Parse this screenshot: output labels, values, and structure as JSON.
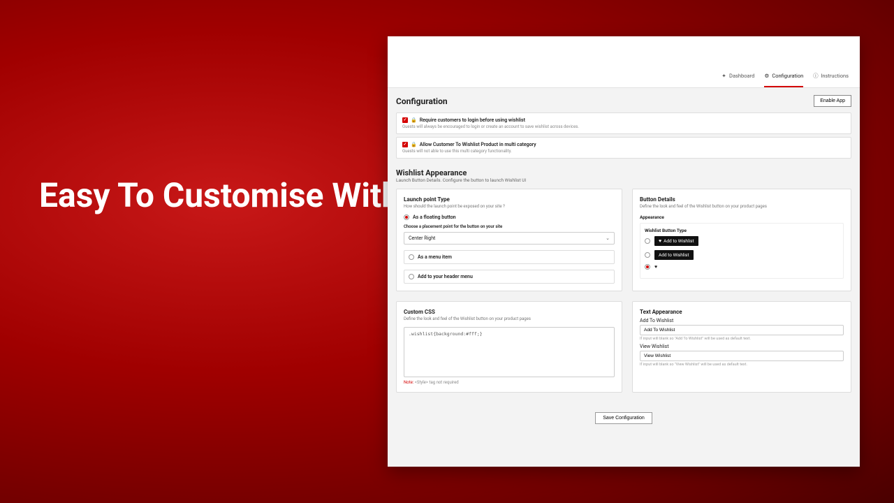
{
  "hero": "Easy To Customise With Custom CSS",
  "nav": {
    "dashboard": "Dashboard",
    "configuration": "Configuration",
    "instructions": "Instructions"
  },
  "page": {
    "title": "Configuration",
    "enable_btn": "Enable App"
  },
  "toggles": {
    "login": {
      "label": "Require customers to login before using wishlist",
      "note": "Guests will always be encouraged to login or create an account to save wishlist across devices."
    },
    "multi": {
      "label": "Allow Customer To Wishlist Product in multi category",
      "note": "Guests will not able to use this multi category functionality."
    }
  },
  "appearance": {
    "title": "Wishlist Appearance",
    "subtitle": "Launch Button Details. Configure the button to launch Wishlist UI"
  },
  "launch": {
    "title": "Launch point Type",
    "subtitle": "How should the launch point be exposed on your site ?",
    "opt_floating": "As a floating button",
    "placement_label": "Choose a placement point for the button on your site",
    "placement_value": "Center Right",
    "opt_menu": "As a menu item",
    "opt_header": "Add to your header menu"
  },
  "button_details": {
    "title": "Button Details",
    "subtitle": "Define the look and feel of the Wishlist button on your product pages",
    "appearance_label": "Appearance",
    "type_label": "Wishlist Button Type",
    "opt1": "Add to Wishlist",
    "opt2": "Add to Wishlist"
  },
  "custom_css": {
    "title": "Custom CSS",
    "subtitle": "Define the look and feel of the Wishlist button on your product pages",
    "code": ".wishlist{background:#fff;}",
    "note_label": "Note:",
    "note_text": " <Style> tag not required"
  },
  "text_appearance": {
    "title": "Text Appearance",
    "add_label": "Add To Wishlist",
    "add_value": "Add To Wishlist",
    "add_hint": "If input will blank so \"Add To Wishlist\" will be used as default text.",
    "view_label": "View Wishlist",
    "view_value": "View Wishlist",
    "view_hint": "If input will blank so \"View Wishlist\" will be used as default text."
  },
  "save_btn": "Save Configuration"
}
